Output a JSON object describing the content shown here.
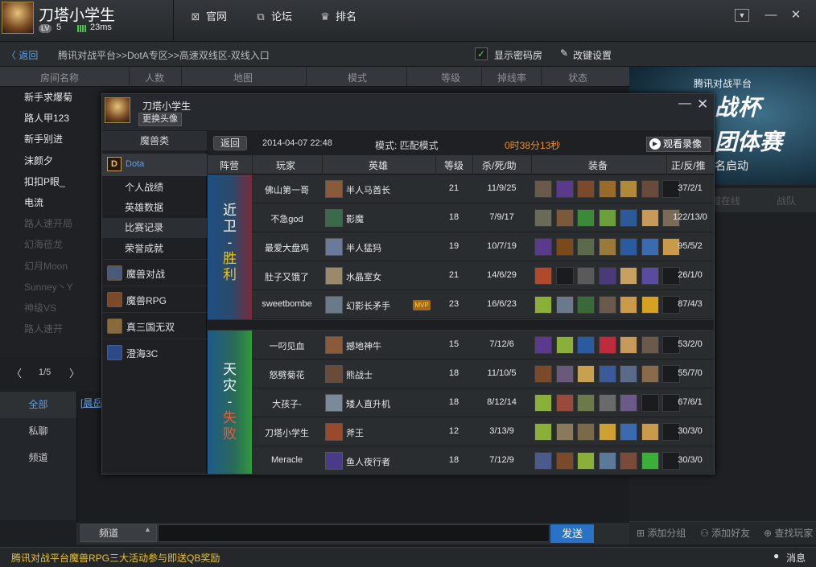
{
  "top": {
    "user_name": "刀塔小学生",
    "lv_label": "LV",
    "lv": "5",
    "ping": "23ms",
    "nav": [
      {
        "icon": "⊠",
        "label": "官网"
      },
      {
        "icon": "⧉",
        "label": "论坛"
      },
      {
        "icon": "♛",
        "label": "排名"
      }
    ]
  },
  "crumb": {
    "back": "〈 返回",
    "path": "腾讯对战平台>>DotA专区>>高速双线区-双线入口",
    "pwd_check": "✓",
    "pwd_label": "显示密码房",
    "settings_icon": "✎",
    "settings_label": "改键设置"
  },
  "room_headers": [
    "房间名称",
    "人数",
    "地图",
    "模式",
    "等级",
    "掉线率",
    "状态"
  ],
  "rooms": [
    {
      "name": "新手求爆菊",
      "dim": false
    },
    {
      "name": "路人甲123",
      "dim": false
    },
    {
      "name": "新手别进",
      "dim": false
    },
    {
      "name": "沫颜夕",
      "dim": false
    },
    {
      "name": "扣扣P眼_",
      "dim": false
    },
    {
      "name": "电流",
      "dim": false
    },
    {
      "name": "路人速开局",
      "dim": true
    },
    {
      "name": "幻海莅龙",
      "dim": true
    },
    {
      "name": "幻月Moon",
      "dim": true
    },
    {
      "name": "Sunney丶Y",
      "dim": true
    },
    {
      "name": "神级VS",
      "dim": true
    },
    {
      "name": "路人速开",
      "dim": true
    }
  ],
  "pager": {
    "prev": "〈",
    "text": "1/5",
    "next": "〉"
  },
  "chat_tabs": [
    "全部",
    "私聊",
    "频道"
  ],
  "chat_link": "[晨岳",
  "channel": "频道",
  "channel_arrow": "▲",
  "send": "发送",
  "banner": {
    "t1": "腾讯对战平台",
    "t2": "战杯",
    "t3": "团体赛",
    "t4": "名启动"
  },
  "friend_tabs": [
    "道在线",
    "战队"
  ],
  "friend_actions": [
    {
      "icon": "⊞",
      "label": "添加分组"
    },
    {
      "icon": "⚇",
      "label": "添加好友"
    },
    {
      "icon": "⊕",
      "label": "查找玩家"
    }
  ],
  "status": {
    "promo": "腾讯对战平台魔兽RPG三大活动参与即送QB奖励",
    "msg_icon": "●",
    "msg": "消息"
  },
  "dialog": {
    "name": "刀塔小学生",
    "change_avatar": "更换头像",
    "min": "—",
    "close": "✕"
  },
  "side": {
    "header": "魔兽类",
    "dota_icon": "D",
    "dota": "Dota",
    "subs": [
      "个人战绩",
      "英雄数据",
      "比赛记录",
      "荣誉成就"
    ],
    "games": [
      "魔兽对战",
      "魔兽RPG",
      "真三国无双",
      "澄海3C"
    ]
  },
  "match": {
    "return": "返回",
    "date": "2014-04-07 22:48",
    "mode": "模式:  匹配模式",
    "duration": "0时38分13秒",
    "watch": "观看录像",
    "watch_icon": "▶",
    "mvp": "MVP",
    "headers": [
      "阵营",
      "玩家",
      "英雄",
      "等级",
      "杀/死/助",
      "装备",
      "正/反/推"
    ],
    "team1": {
      "chars": [
        "近",
        "卫",
        "-",
        "胜",
        "利"
      ],
      "colors": [
        "#ffffff",
        "#ffffff",
        "#ffffff",
        "#f0c419",
        "#f0c419"
      ]
    },
    "team2": {
      "chars": [
        "天",
        "灾",
        "-",
        "失",
        "败"
      ],
      "colors": [
        "#ffffff",
        "#ffffff",
        "#ffffff",
        "#ff5533",
        "#ff5533"
      ]
    },
    "players": [
      {
        "player": "佛山第一哥",
        "hero": "半人马酋长",
        "level": "21",
        "kda": "11/9/25",
        "score": "37/2/1",
        "hc": "#8a5a3a",
        "items": [
          "#6a5a4a",
          "#5a3a8a",
          "#7a4a2a",
          "#9a6a2a",
          "#b08a3a",
          "#6a4a3a",
          ""
        ]
      },
      {
        "player": "不急god",
        "hero": "影魔",
        "level": "18",
        "kda": "7/9/17",
        "score": "122/13/0",
        "hc": "#3a6a4a",
        "items": [
          "#6a6a5a",
          "#7a5a3a",
          "#3a8a3a",
          "#6aa03a",
          "#2a5a9a",
          "#c89a5a",
          "#7a6a5a"
        ]
      },
      {
        "player": "最爱大盘鸡",
        "hero": "半人猛犸",
        "level": "19",
        "kda": "10/7/19",
        "score": "95/5/2",
        "hc": "#6a7a9a",
        "items": [
          "#5a3a8a",
          "#7a4a1a",
          "#5a6a4a",
          "#9a7a3a",
          "#2a5aa0",
          "#3a6ab0",
          "#c89a4a"
        ]
      },
      {
        "player": "肚子又饿了",
        "hero": "水晶室女",
        "level": "21",
        "kda": "14/6/29",
        "score": "26/1/0",
        "hc": "#9a8a6a",
        "items": [
          "#b04a2a",
          "",
          "#5a5a5a",
          "#4a3a7a",
          "#c8a060",
          "#5a4aa0",
          ""
        ]
      },
      {
        "player": "sweetbombe",
        "hero": "幻影长矛手",
        "level": "23",
        "kda": "16/6/23",
        "score": "87/4/3",
        "hc": "#6a7a8a",
        "items": [
          "#8ab03a",
          "#6a7a8a",
          "#3a6a3a",
          "#6a5a4a",
          "#c89a4a",
          "#d8a020",
          ""
        ]
      },
      {
        "player": "一叼见血",
        "hero": "撼地神牛",
        "level": "15",
        "kda": "7/12/6",
        "score": "53/2/0",
        "hc": "#8a5a3a",
        "items": [
          "#5a3a8a",
          "#8ab03a",
          "#2a5aa0",
          "#c02a3a",
          "#c89a5a",
          "#6a5a4a",
          ""
        ]
      },
      {
        "player": "怒劈菊花",
        "hero": "熊战士",
        "level": "18",
        "kda": "11/10/5",
        "score": "55/7/0",
        "hc": "#6a4a3a",
        "items": [
          "#7a4a2a",
          "#6a5a7a",
          "#c8a050",
          "#3a5a9a",
          "#5a6a8a",
          "#8a6a4a",
          ""
        ]
      },
      {
        "player": "大孩子-",
        "hero": "矮人直升机",
        "level": "18",
        "kda": "8/12/14",
        "score": "67/6/1",
        "hc": "#7a8a9a",
        "items": [
          "#8ab03a",
          "#9a4a3a",
          "#6a7a4a",
          "#6a6a6a",
          "#6a5a8a",
          "",
          ""
        ]
      },
      {
        "player": "刀塔小学生",
        "hero": "斧王",
        "level": "12",
        "kda": "3/13/9",
        "score": "30/3/0",
        "hc": "#9a4a2a",
        "items": [
          "#8ab03a",
          "#8a7a5a",
          "#7a6a4a",
          "#d0a030",
          "#3a6ab0",
          "#c89a4a",
          ""
        ]
      },
      {
        "player": "Meracle",
        "hero": "鱼人夜行者",
        "level": "18",
        "kda": "7/12/9",
        "score": "30/3/0",
        "hc": "#4a3a8a",
        "items": [
          "#4a5a8a",
          "#7a4a2a",
          "#8ab03a",
          "#5a7a9a",
          "#7a4a3a",
          "#3ab03a",
          ""
        ]
      }
    ]
  }
}
